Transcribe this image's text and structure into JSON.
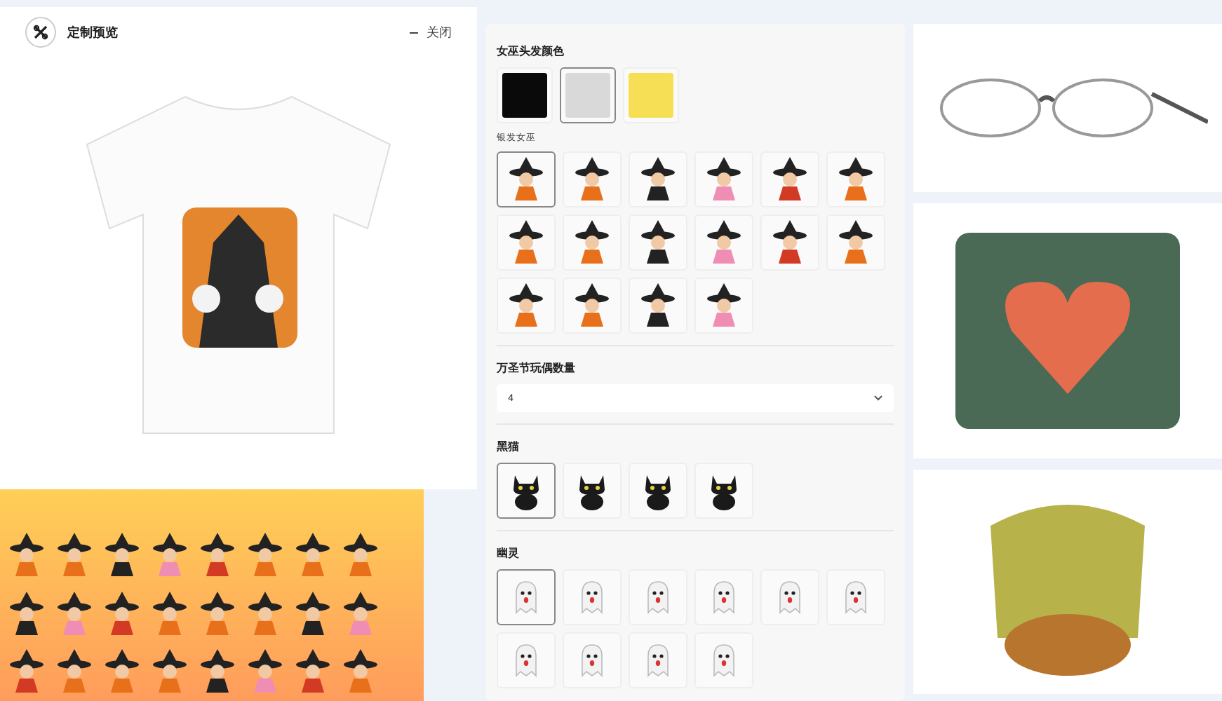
{
  "header": {
    "title": "定制预览",
    "close_label": "关闭"
  },
  "options": [
    {
      "kind": "colors",
      "title": "女巫头发颜色",
      "choices": [
        {
          "color": "#0a0a0a",
          "selected": false
        },
        {
          "color": "#d9d9d9",
          "selected": true
        },
        {
          "color": "#f7df55",
          "selected": false
        }
      ]
    },
    {
      "kind": "witches",
      "subtitle": "银发女巫",
      "choices": [
        {
          "selected": true
        },
        {
          "selected": false
        },
        {
          "selected": false
        },
        {
          "selected": false
        },
        {
          "selected": false
        },
        {
          "selected": false
        },
        {
          "selected": false
        },
        {
          "selected": false
        },
        {
          "selected": false
        },
        {
          "selected": false
        },
        {
          "selected": false
        },
        {
          "selected": false
        },
        {
          "selected": false
        },
        {
          "selected": false
        },
        {
          "selected": false
        },
        {
          "selected": false
        }
      ]
    },
    {
      "kind": "select",
      "title": "万圣节玩偶数量",
      "value": "4"
    },
    {
      "kind": "cats",
      "title": "黑猫",
      "choices": [
        {
          "selected": true
        },
        {
          "selected": false
        },
        {
          "selected": false
        },
        {
          "selected": false
        }
      ]
    },
    {
      "kind": "ghosts",
      "title": "幽灵",
      "choices": [
        {
          "selected": true
        },
        {
          "selected": false
        },
        {
          "selected": false
        },
        {
          "selected": false
        },
        {
          "selected": false
        },
        {
          "selected": false
        },
        {
          "selected": false
        },
        {
          "selected": false
        },
        {
          "selected": false
        },
        {
          "selected": false
        }
      ]
    }
  ]
}
